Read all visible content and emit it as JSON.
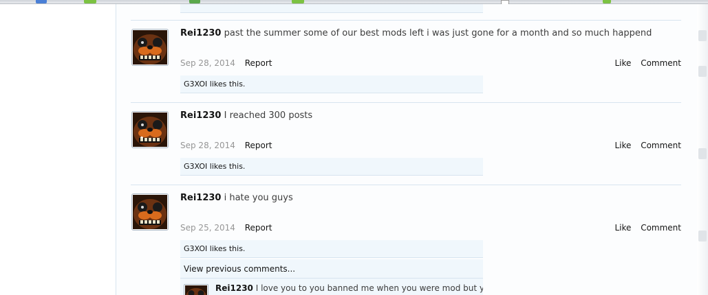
{
  "colors": {
    "page_background": "#ffffff",
    "content_background": "#fcfdfe",
    "likes_bar_background": "#f0f7fc",
    "separator": "#d7e4ef",
    "date_text": "#969696",
    "body_text": "#141414"
  },
  "profile_posts": [
    {
      "username": "Rei1230",
      "message": "past the summer some of our best mods left i was just gone for a month and so much happend",
      "date": "Sep 28, 2014",
      "report_label": "Report",
      "like_label": "Like",
      "comment_label": "Comment",
      "liked_by": "G3XOI",
      "likes_suffix": " likes this.",
      "avatar": "freddy-avatar-icon"
    },
    {
      "username": "Rei1230",
      "message": "I reached 300 posts",
      "date": "Sep 28, 2014",
      "report_label": "Report",
      "like_label": "Like",
      "comment_label": "Comment",
      "liked_by": "G3XOI",
      "likes_suffix": " likes this.",
      "avatar": "freddy-avatar-icon"
    },
    {
      "username": "Rei1230",
      "message": "i hate you guys",
      "date": "Sep 25, 2014",
      "report_label": "Report",
      "like_label": "Like",
      "comment_label": "Comment",
      "liked_by": "G3XOI",
      "likes_suffix": " likes this.",
      "avatar": "freddy-avatar-icon",
      "view_previous_label": "View previous comments...",
      "comment": {
        "username": "Rei1230",
        "message": "I love you to you banned me when you were mod but you"
      }
    }
  ]
}
